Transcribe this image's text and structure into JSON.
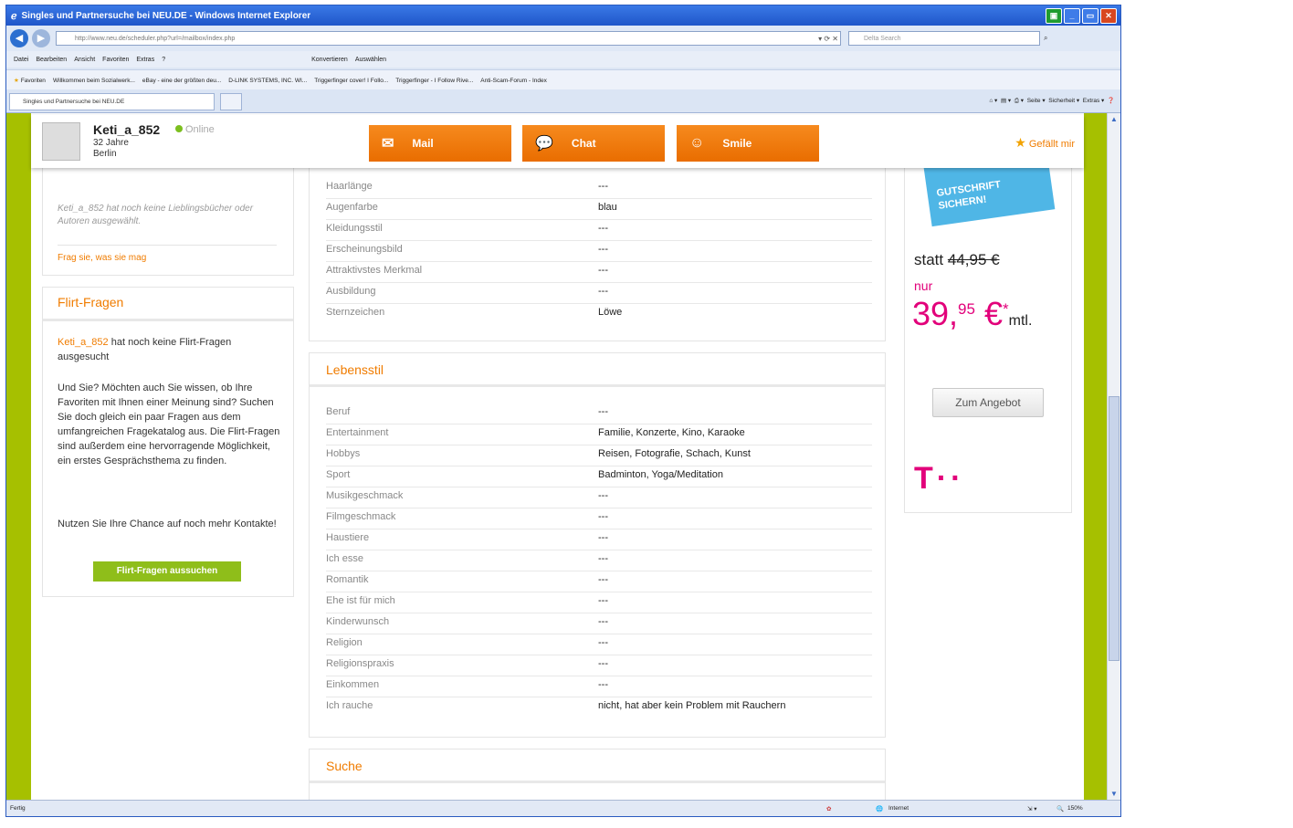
{
  "window": {
    "title": "Singles und Partnersuche bei NEU.DE - Windows Internet Explorer",
    "address": "http://www.neu.de/scheduler.php?url=/mailbox/index.php",
    "search_placeholder": "Delta Search"
  },
  "menu": [
    "Datei",
    "Bearbeiten",
    "Ansicht",
    "Favoriten",
    "Extras",
    "?",
    "Konvertieren",
    "Auswählen"
  ],
  "favorites": {
    "label": "Favoriten",
    "items": [
      "Willkommen beim Sozialwerk...",
      "eBay - eine der größten deu...",
      "D-LINK SYSTEMS, INC. WI...",
      "Triggerfinger cover! I Follo...",
      "Triggerfinger - I Follow Rive...",
      "Anti-Scam-Forum - Index"
    ]
  },
  "tab": {
    "title": "Singles und Partnersuche bei NEU.DE"
  },
  "commandbar": [
    "Seite",
    "Sicherheit",
    "Extras"
  ],
  "profile": {
    "name": "Keti_a_852",
    "online": "Online",
    "age": "32 Jahre",
    "city": "Berlin",
    "buttons": {
      "mail": "Mail",
      "chat": "Chat",
      "smile": "Smile"
    },
    "like": "Gefällt mir"
  },
  "left": {
    "books_text": "Keti_a_852 hat noch keine Lieblingsbücher oder Autoren ausgewählt.",
    "books_link": "Frag sie, was sie mag",
    "flirt_title": "Flirt-Fragen",
    "flirt_name": "Keti_a_852",
    "flirt_line1": "hat noch keine Flirt-Fragen ausgesucht",
    "flirt_para2": "Und Sie? Möchten auch Sie wissen, ob Ihre Favoriten mit Ihnen einer Meinung sind? Suchen Sie doch gleich ein paar Fragen aus dem umfangreichen Fragekatalog aus. Die Flirt-Fragen sind außerdem eine hervorragende Möglichkeit, ein erstes Gesprächsthema zu finden.",
    "flirt_para3": "Nutzen Sie Ihre Chance auf noch mehr Kontakte!",
    "flirt_button": "Flirt-Fragen aussuchen"
  },
  "appearance": [
    {
      "label": "Haarlänge",
      "value": "---"
    },
    {
      "label": "Augenfarbe",
      "value": "blau"
    },
    {
      "label": "Kleidungsstil",
      "value": "---"
    },
    {
      "label": "Erscheinungsbild",
      "value": "---"
    },
    {
      "label": "Attraktivstes Merkmal",
      "value": "---"
    },
    {
      "label": "Ausbildung",
      "value": "---"
    },
    {
      "label": "Sternzeichen",
      "value": "Löwe"
    }
  ],
  "lifestyle": {
    "title": "Lebensstil",
    "rows": [
      {
        "label": "Beruf",
        "value": "---"
      },
      {
        "label": "Entertainment",
        "value": "Familie, Konzerte, Kino, Karaoke"
      },
      {
        "label": "Hobbys",
        "value": "Reisen, Fotografie, Schach, Kunst"
      },
      {
        "label": "Sport",
        "value": "Badminton, Yoga/Meditation"
      },
      {
        "label": "Musikgeschmack",
        "value": "---"
      },
      {
        "label": "Filmgeschmack",
        "value": "---"
      },
      {
        "label": "Haustiere",
        "value": "---"
      },
      {
        "label": "Ich esse",
        "value": "---"
      },
      {
        "label": "Romantik",
        "value": "---"
      },
      {
        "label": "Ehe ist für mich",
        "value": "---"
      },
      {
        "label": "Kinderwunsch",
        "value": "---"
      },
      {
        "label": "Religion",
        "value": "---"
      },
      {
        "label": "Religionspraxis",
        "value": "---"
      },
      {
        "label": "Einkommen",
        "value": "---"
      },
      {
        "label": "Ich rauche",
        "value": "nicht, hat aber kein Problem mit Rauchern"
      }
    ]
  },
  "search_section": {
    "title": "Suche"
  },
  "ad": {
    "badge_line1": "GUTSCHRIFT",
    "badge_line2": "SICHERN!",
    "statt": "statt",
    "old_price": "44,95 €",
    "nur": "nur",
    "price_main": "39,",
    "price_cents": "95",
    "price_currency": "€",
    "price_star": "*",
    "price_unit": "mtl.",
    "button": "Zum Angebot",
    "logo": "T··"
  },
  "status": {
    "left": "Fertig",
    "zone": "Internet",
    "zoom": "150%"
  }
}
